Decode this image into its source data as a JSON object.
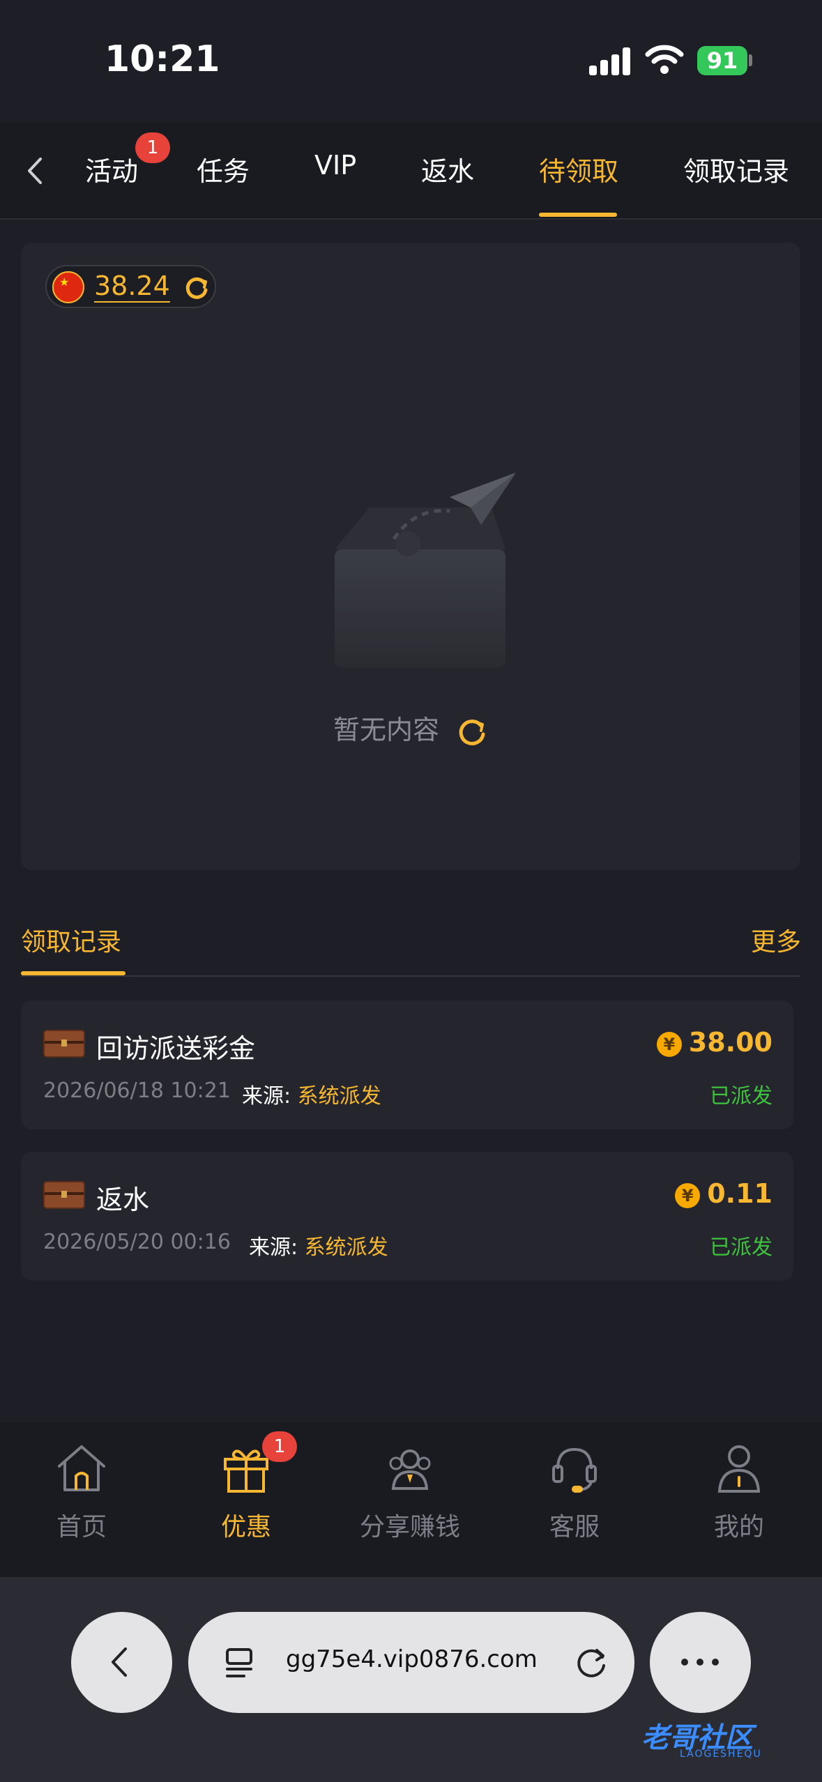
{
  "status_bar": {
    "time": "10:21",
    "battery": "91"
  },
  "tabs": [
    {
      "label": "活动",
      "badge": "1"
    },
    {
      "label": "任务"
    },
    {
      "label": "VIP"
    },
    {
      "label": "返水"
    },
    {
      "label": "待领取",
      "active": true
    },
    {
      "label": "领取记录"
    }
  ],
  "wallet": {
    "balance": "38.24"
  },
  "empty_state": {
    "text": "暂无内容"
  },
  "records_section": {
    "title": "领取记录",
    "more": "更多"
  },
  "records": [
    {
      "title": "回访派送彩金",
      "amount": "38.00",
      "date": "2026/06/18 10:21",
      "source_label": "来源:",
      "source": "系统派发",
      "status": "已派发"
    },
    {
      "title": "返水",
      "amount": "0.11",
      "date": "2026/05/20 00:16",
      "source_label": "来源:",
      "source": "系统派发",
      "status": "已派发"
    }
  ],
  "bottom_nav": [
    {
      "label": "首页",
      "icon": "home-icon"
    },
    {
      "label": "优惠",
      "icon": "gift-icon",
      "active": true,
      "badge": "1"
    },
    {
      "label": "分享赚钱",
      "icon": "share-users-icon"
    },
    {
      "label": "客服",
      "icon": "headset-icon"
    },
    {
      "label": "我的",
      "icon": "user-icon"
    }
  ],
  "browser": {
    "url": "gg75e4.vip0876.com"
  },
  "watermark": {
    "text": "老哥社区",
    "sub": "LAOGESHEQU"
  },
  "colors": {
    "accent": "#f7b731",
    "success": "#3ec23e",
    "badge": "#e8433a",
    "background": "#1e1f26"
  }
}
